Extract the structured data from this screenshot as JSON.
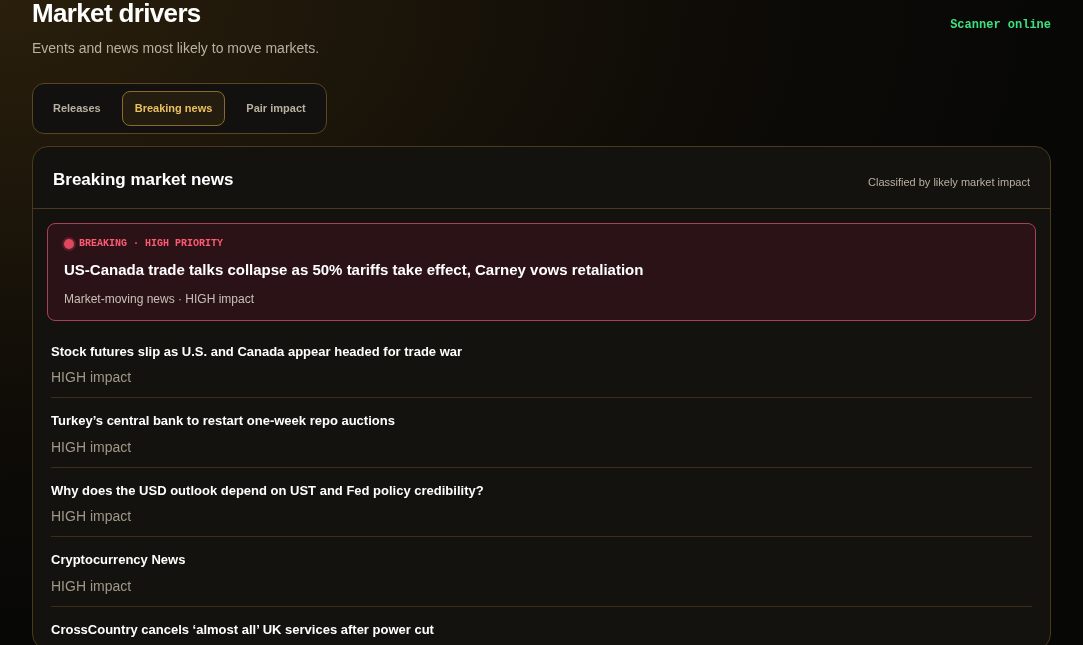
{
  "header": {
    "title": "Market drivers",
    "subtitle": "Events and news most likely to move markets.",
    "status": "Scanner online"
  },
  "tabs": [
    {
      "label": "Releases",
      "selected": false
    },
    {
      "label": "Breaking news",
      "selected": true
    },
    {
      "label": "Pair impact",
      "selected": false
    }
  ],
  "panel": {
    "title": "Breaking market news",
    "note": "Classified by likely market impact",
    "featured": {
      "label": "BREAKING · HIGH PRIORITY",
      "headline": "US-Canada trade talks collapse as 50% tariffs take effect, Carney vows retaliation",
      "meta": "Market-moving news · HIGH impact"
    },
    "items": [
      {
        "headline": "Stock futures slip as U.S. and Canada appear headed for trade war",
        "impact": "HIGH impact"
      },
      {
        "headline": "Turkey’s central bank to restart one-week repo auctions",
        "impact": "HIGH impact"
      },
      {
        "headline": "Why does the USD outlook depend on UST and Fed policy credibility?",
        "impact": "HIGH impact"
      },
      {
        "headline": "Cryptocurrency News",
        "impact": "HIGH impact"
      },
      {
        "headline": "CrossCountry cancels ‘almost all’ UK services after power cut"
      }
    ]
  }
}
